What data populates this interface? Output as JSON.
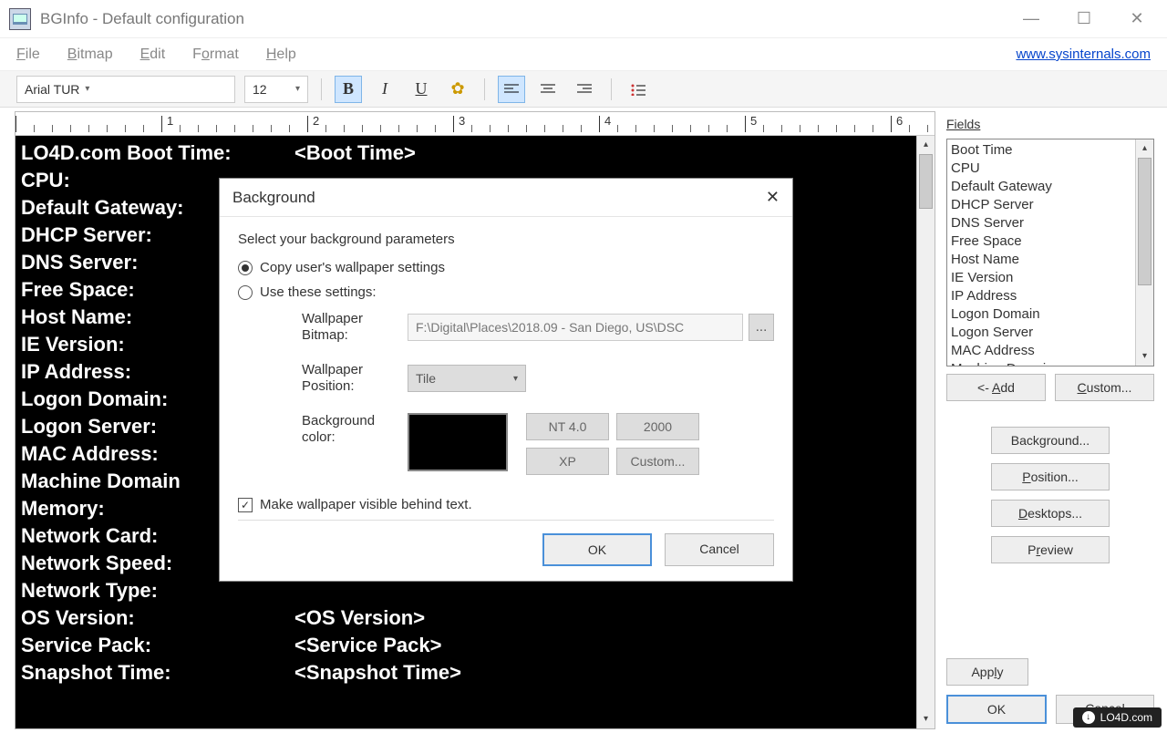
{
  "window": {
    "title": "BGInfo - Default configuration"
  },
  "menubar": {
    "file": "File",
    "bitmap": "Bitmap",
    "edit": "Edit",
    "format": "Format",
    "help": "Help",
    "link": "www.sysinternals.com"
  },
  "toolbar": {
    "font": "Arial TUR",
    "size": "12"
  },
  "editor": {
    "rows": [
      {
        "label": "LO4D.com Boot Time:",
        "value": "<Boot Time>"
      },
      {
        "label": "CPU:",
        "value": ""
      },
      {
        "label": "Default Gateway:",
        "value": ""
      },
      {
        "label": "DHCP Server:",
        "value": ""
      },
      {
        "label": "DNS Server:",
        "value": ""
      },
      {
        "label": "Free Space:",
        "value": ""
      },
      {
        "label": "Host Name:",
        "value": ""
      },
      {
        "label": "IE Version:",
        "value": ""
      },
      {
        "label": "IP Address:",
        "value": ""
      },
      {
        "label": "Logon Domain:",
        "value": ""
      },
      {
        "label": "Logon Server:",
        "value": ""
      },
      {
        "label": "MAC Address:",
        "value": ""
      },
      {
        "label": "Machine Domain",
        "value": ""
      },
      {
        "label": "Memory:",
        "value": ""
      },
      {
        "label": "Network Card:",
        "value": ""
      },
      {
        "label": "Network Speed:",
        "value": ""
      },
      {
        "label": "Network Type:",
        "value": ""
      },
      {
        "label": "OS Version:",
        "value": "<OS Version>"
      },
      {
        "label": "Service Pack:",
        "value": "<Service Pack>"
      },
      {
        "label": "Snapshot Time:",
        "value": "<Snapshot Time>"
      }
    ]
  },
  "fields": {
    "heading": "Fields",
    "items": [
      "Boot Time",
      "CPU",
      "Default Gateway",
      "DHCP Server",
      "DNS Server",
      "Free Space",
      "Host Name",
      "IE Version",
      "IP Address",
      "Logon Domain",
      "Logon Server",
      "MAC Address",
      "Machine Domain"
    ],
    "add_btn": "<- Add",
    "custom_btn": "Custom..."
  },
  "right_buttons": {
    "background": "Background...",
    "position": "Position...",
    "desktops": "Desktops...",
    "preview": "Preview",
    "apply": "Apply",
    "ok": "OK",
    "cancel": "Cancel"
  },
  "dialog": {
    "title": "Background",
    "prompt": "Select your background parameters",
    "radio1": "Copy user's wallpaper settings",
    "radio2": "Use these settings:",
    "wallpaper_bitmap_label": "Wallpaper Bitmap:",
    "wallpaper_bitmap_value": "F:\\Digital\\Places\\2018.09 - San Diego, US\\DSC",
    "browse": "...",
    "wallpaper_position_label": "Wallpaper Position:",
    "wallpaper_position_value": "Tile",
    "bg_color_label": "Background color:",
    "presets": {
      "nt4": "NT 4.0",
      "win2000": "2000",
      "xp": "XP",
      "custom": "Custom..."
    },
    "checkbox_label": "Make wallpaper visible behind text.",
    "ok": "OK",
    "cancel": "Cancel"
  },
  "watermark": "LO4D.com"
}
